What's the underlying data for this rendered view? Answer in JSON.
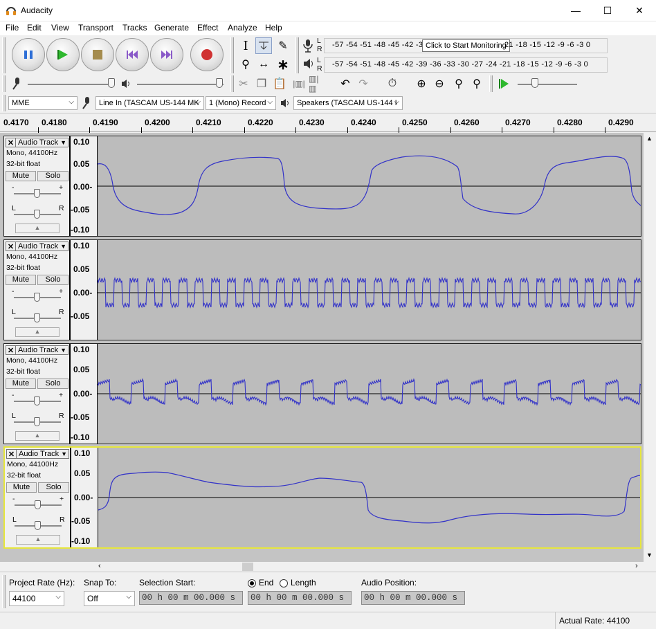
{
  "window": {
    "title": "Audacity",
    "minimize_glyph": "—",
    "maximize_glyph": "☐",
    "close_glyph": "✕"
  },
  "menu": [
    "File",
    "Edit",
    "View",
    "Transport",
    "Tracks",
    "Generate",
    "Effect",
    "Analyze",
    "Help"
  ],
  "meters": {
    "record_scale": "-57 -54 -51 -48 -45 -42 -3",
    "record_scale_right": "21 -18 -15 -12 -9 -6 -3 0",
    "tooltip": "Click to Start Monitoring",
    "playback_scale": "-57 -54 -51 -48 -45 -42 -39 -36 -33 -30 -27 -24 -21 -18 -15 -12 -9 -6 -3 0",
    "channel_l": "L",
    "channel_r": "R"
  },
  "devices": {
    "host": "MME",
    "input": "Line In (TASCAM US-144 MK",
    "channels": "1 (Mono) Record",
    "output": "Speakers (TASCAM US-144 I"
  },
  "ruler": [
    "0.4170",
    "0.4180",
    "0.4190",
    "0.4200",
    "0.4210",
    "0.4220",
    "0.4230",
    "0.4240",
    "0.4250",
    "0.4260",
    "0.4270",
    "0.4280",
    "0.4290"
  ],
  "tracks": [
    {
      "name": "Audio Track",
      "info1": "Mono, 44100Hz",
      "info2": "32-bit float",
      "mute": "Mute",
      "solo": "Solo",
      "vlabels": [
        "0.10",
        "0.05",
        "0.00-",
        "-0.05",
        "-0.10"
      ],
      "selected": false
    },
    {
      "name": "Audio Track",
      "info1": "Mono, 44100Hz",
      "info2": "32-bit float",
      "mute": "Mute",
      "solo": "Solo",
      "vlabels": [
        "0.10",
        "0.05",
        "0.00-",
        "-0.05"
      ],
      "selected": false
    },
    {
      "name": "Audio Track",
      "info1": "Mono, 44100Hz",
      "info2": "32-bit float",
      "mute": "Mute",
      "solo": "Solo",
      "vlabels": [
        "0.10",
        "0.05",
        "0.00-",
        "-0.05",
        "-0.10"
      ],
      "selected": false
    },
    {
      "name": "Audio Track",
      "info1": "Mono, 44100Hz",
      "info2": "32-bit float",
      "mute": "Mute",
      "solo": "Solo",
      "vlabels": [
        "0.10",
        "0.05",
        "0.00-",
        "-0.05",
        "-0.10"
      ],
      "selected": true
    }
  ],
  "gain_labels": {
    "minus": "-",
    "plus": "+",
    "left": "L",
    "right": "R"
  },
  "selection": {
    "project_rate_label": "Project Rate (Hz):",
    "project_rate": "44100",
    "snap_label": "Snap To:",
    "snap_value": "Off",
    "sel_start_label": "Selection Start:",
    "end_label": "End",
    "length_label": "Length",
    "audio_pos_label": "Audio Position:",
    "time_value": "00 h 00 m 00.000 s"
  },
  "status": {
    "actual_rate": "Actual Rate: 44100"
  },
  "colors": {
    "waveform": "#3232c8",
    "track_bg": "#bcbcbc",
    "selected_border": "#e6e63c"
  }
}
